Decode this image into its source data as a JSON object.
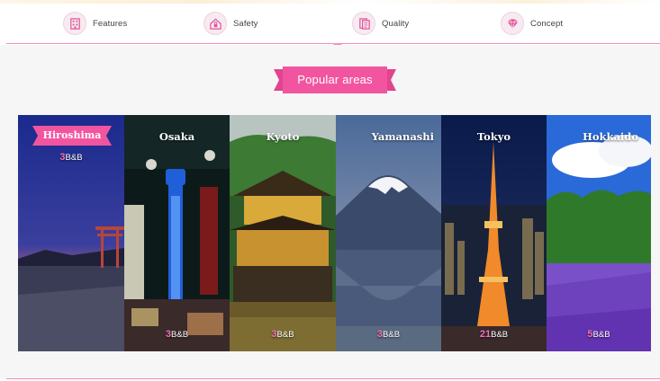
{
  "nav": {
    "items": [
      {
        "label": "Features",
        "icon": "building-icon"
      },
      {
        "label": "Safety",
        "icon": "house-lock-icon"
      },
      {
        "label": "Quality",
        "icon": "document-icon"
      },
      {
        "label": "Concept",
        "icon": "diamond-icon"
      }
    ]
  },
  "section": {
    "title": "Popular areas"
  },
  "areas": [
    {
      "name": "Hiroshima",
      "count": "3",
      "unit": "B&B",
      "scene": "torii-sunset"
    },
    {
      "name": "Osaka",
      "count": "3",
      "unit": "B&B",
      "scene": "tsutenkaku-night"
    },
    {
      "name": "Kyoto",
      "count": "3",
      "unit": "B&B",
      "scene": "golden-pavilion"
    },
    {
      "name": "Yamanashi",
      "count": "3",
      "unit": "B&B",
      "scene": "mount-fuji"
    },
    {
      "name": "Tokyo",
      "count": "21",
      "unit": "B&B",
      "scene": "tokyo-tower-night"
    },
    {
      "name": "Hokkaido",
      "count": "5",
      "unit": "B&B",
      "scene": "lavender-field"
    }
  ],
  "colors": {
    "accent": "#f472b6",
    "ribbon": "#f2559f",
    "line": "#f58ec0"
  }
}
